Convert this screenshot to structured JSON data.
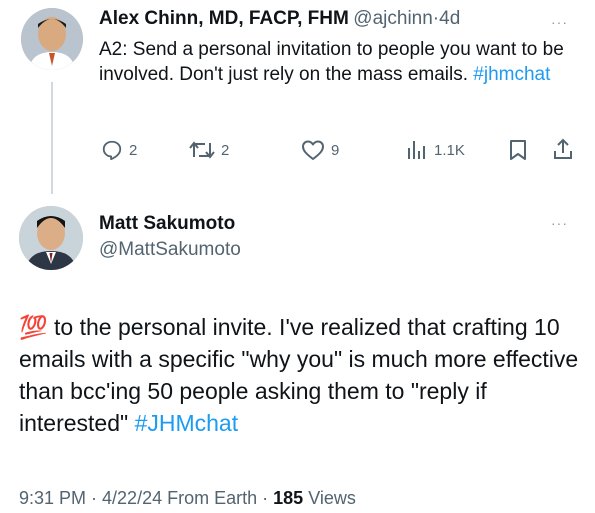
{
  "reply_tweet": {
    "author_name": "Alex Chinn, MD, FACP, FHM",
    "handle": "@ajchinn",
    "separator": "·",
    "time": "4d",
    "more": "···",
    "text": "A2: Send a personal invitation to people you want to be involved. Don't just rely on the mass emails.",
    "hashtag": "#jhmchat",
    "actions": {
      "replies": "2",
      "reposts": "2",
      "likes": "9",
      "views": "1.1K"
    }
  },
  "main_tweet": {
    "author_name": "Matt Sakumoto",
    "handle": "@MattSakumoto",
    "more": "···",
    "emoji": "💯",
    "text": "to the personal invite. I've realized that crafting 10 emails with a specific \"why you\" is much more effective than bcc'ing 50 people asking them to \"reply if interested\"",
    "hashtag": "#JHMchat",
    "timestamp": "9:31 PM · 4/22/24 From Earth ·",
    "views_count": "185",
    "views_label": "Views"
  },
  "colors": {
    "link": "#1d9bf0",
    "secondary": "#536471",
    "primary": "#0f1419",
    "thread_line": "#cfd9de"
  }
}
